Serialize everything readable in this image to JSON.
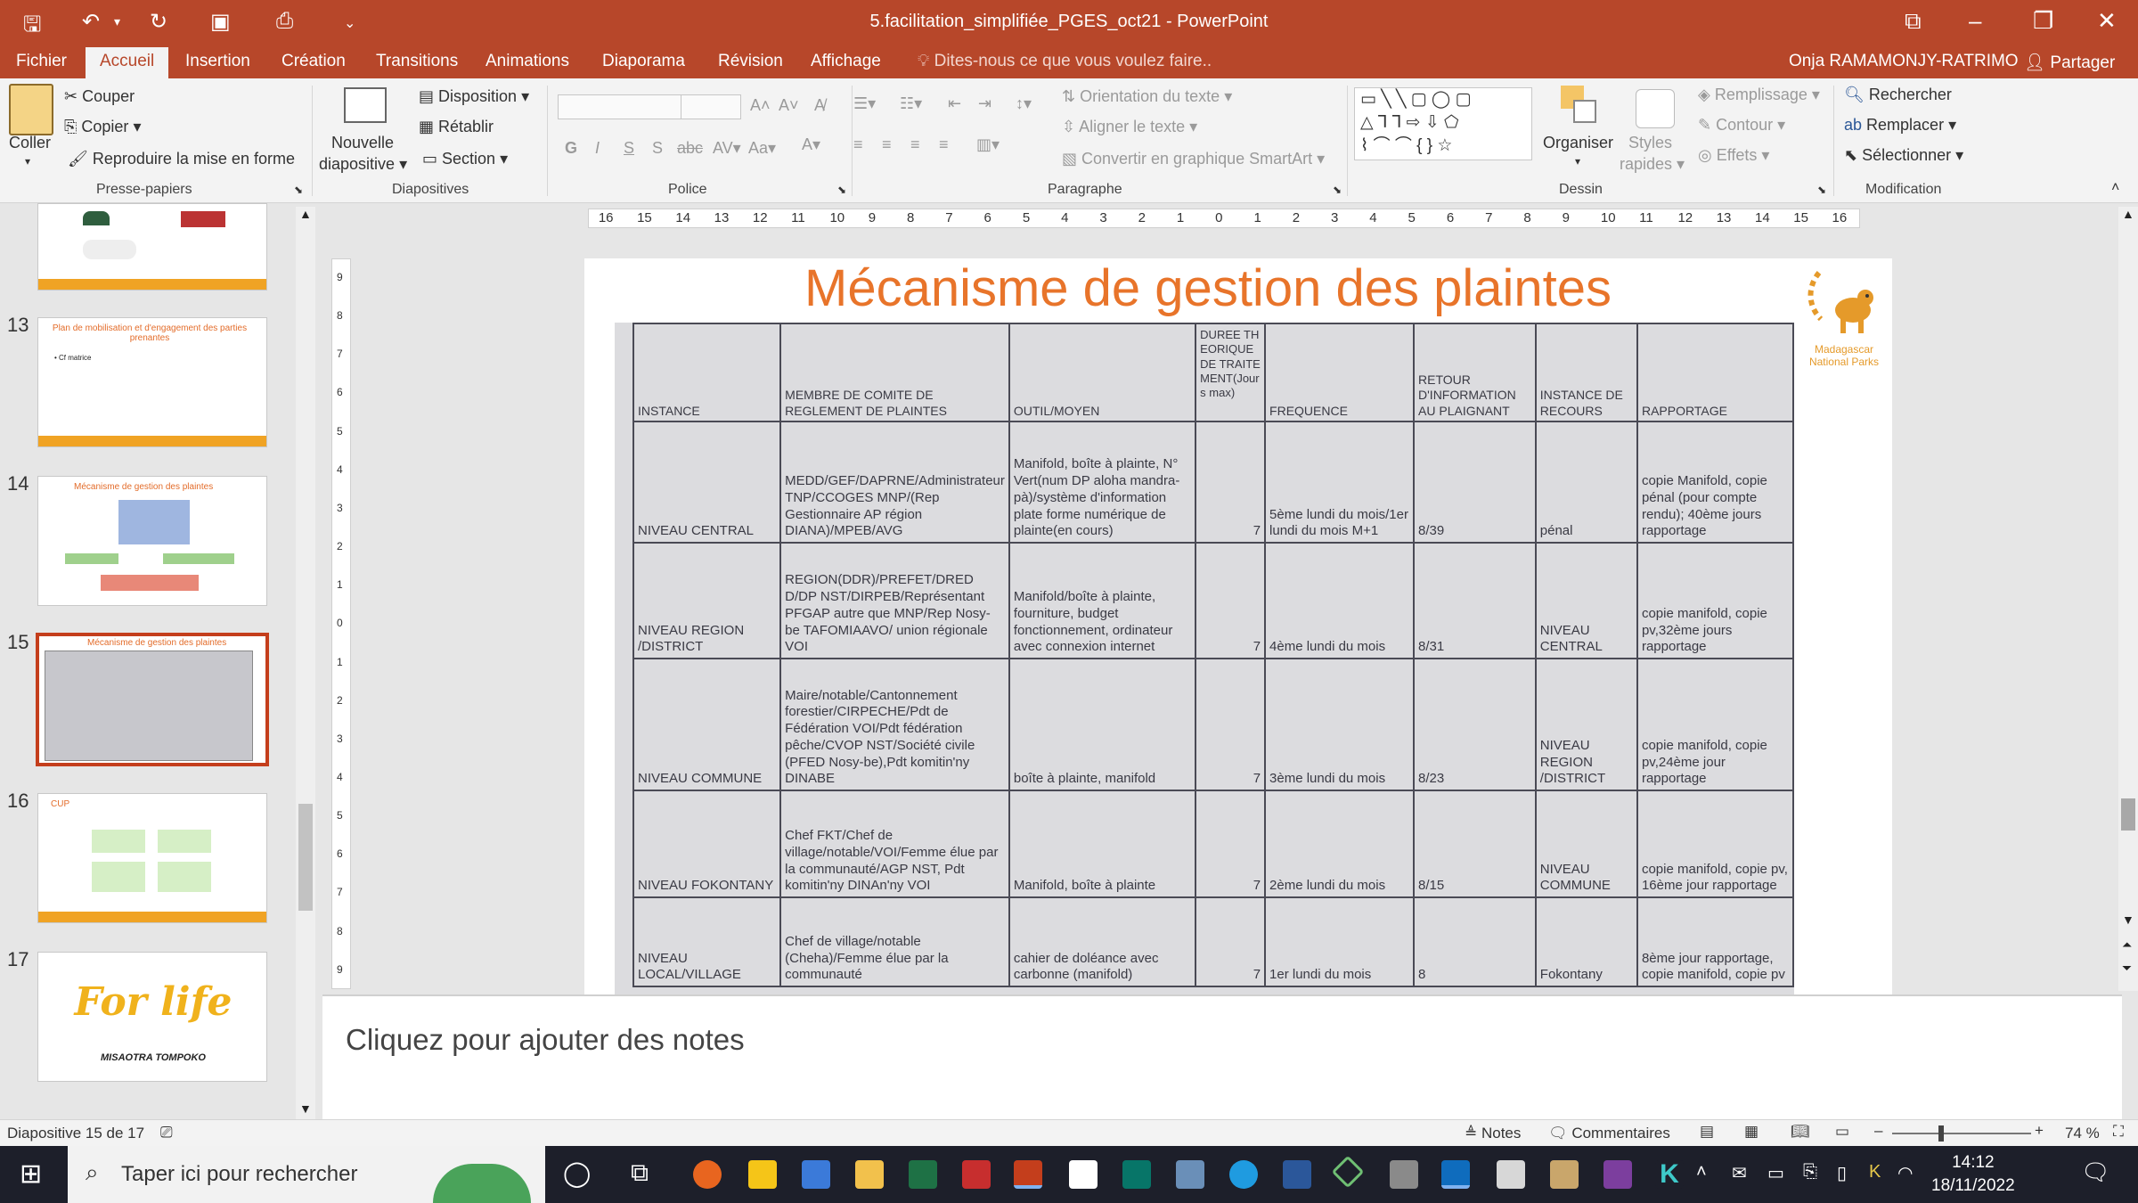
{
  "window": {
    "title": "5.facilitation_simplifiée_PGES_oct21 - PowerPoint",
    "qat_more": "⌄"
  },
  "tabs": [
    "Fichier",
    "Accueil",
    "Insertion",
    "Création",
    "Transitions",
    "Animations",
    "Diaporama",
    "Révision",
    "Affichage"
  ],
  "tell_me": "Dites-nous ce que vous voulez faire..",
  "user": "Onja RAMAMONJY-RATRIMO",
  "share": "Partager",
  "ribbon": {
    "clipboard": {
      "paste": "Coller",
      "cut": "Couper",
      "copy": "Copier",
      "format_painter": "Reproduire la mise en forme",
      "group": "Presse-papiers"
    },
    "slides": {
      "new_slide": "Nouvelle",
      "new_slide2": "diapositive",
      "layout": "Disposition",
      "reset": "Rétablir",
      "section": "Section",
      "group": "Diapositives"
    },
    "font": {
      "group": "Police"
    },
    "paragraph": {
      "text_direction": "Orientation du texte",
      "align_text": "Aligner le texte",
      "smartart": "Convertir en graphique SmartArt",
      "group": "Paragraphe"
    },
    "drawing": {
      "arrange": "Organiser",
      "quick_styles": "Styles",
      "quick_styles2": "rapides",
      "fill": "Remplissage",
      "outline": "Contour",
      "effects": "Effets",
      "group": "Dessin"
    },
    "editing": {
      "find": "Rechercher",
      "replace": "Remplacer",
      "select": "Sélectionner",
      "group": "Modification"
    }
  },
  "ruler": {
    "h_ticks": [
      "16",
      "15",
      "14",
      "13",
      "12",
      "11",
      "10",
      "9",
      "8",
      "7",
      "6",
      "5",
      "4",
      "3",
      "2",
      "1",
      "0",
      "1",
      "2",
      "3",
      "4",
      "5",
      "6",
      "7",
      "8",
      "9",
      "10",
      "11",
      "12",
      "13",
      "14",
      "15",
      "16"
    ],
    "v_ticks": [
      "9",
      "8",
      "7",
      "6",
      "5",
      "4",
      "3",
      "2",
      "1",
      "0",
      "1",
      "2",
      "3",
      "4",
      "5",
      "6",
      "7",
      "8",
      "9"
    ]
  },
  "thumbnails": [
    {
      "num": "",
      "title": ""
    },
    {
      "num": "13",
      "title": "Plan de mobilisation et d'engagement des parties prenantes",
      "bullet": "• Cf matrice"
    },
    {
      "num": "14",
      "title": "Mécanisme de gestion des plaintes"
    },
    {
      "num": "15",
      "title": "Mécanisme de gestion des plaintes"
    },
    {
      "num": "16",
      "title": "CUP"
    },
    {
      "num": "17",
      "title": "For life",
      "subtitle": "MISAOTRA TOMPOKO"
    }
  ],
  "slide": {
    "title": "Mécanisme de gestion des plaintes",
    "logo_text": [
      "Madagascar",
      "National Parks"
    ],
    "table": {
      "headers": [
        "INSTANCE",
        "MEMBRE DE COMITE DE REGLEMENT DE PLAINTES",
        "OUTIL/MOYEN",
        "DUREE THEORIQUE DE TRAITEMENT(Jours max)",
        "FREQUENCE",
        "RETOUR D'INFORMATION AU PLAIGNANT",
        "INSTANCE DE RECOURS",
        "RAPPORTAGE"
      ],
      "rows": [
        [
          "NIVEAU CENTRAL",
          "MEDD/GEF/DAPRNE/Administrateur TNP/CCOGES MNP/(Rep Gestionnaire AP région DIANA)/MPEB/AVG",
          "Manifold, boîte à plainte, N° Vert(num DP aloha mandra-pà)/système d'information plate forme numérique de plainte(en cours)",
          "7",
          "5ème lundi du mois/1er lundi du mois M+1",
          "8/39",
          "pénal",
          "copie Manifold, copie pénal (pour compte rendu); 40ème jours rapportage"
        ],
        [
          "NIVEAU REGION /DISTRICT",
          "REGION(DDR)/PREFET/DRED D/DP NST/DIRPEB/Représentant PFGAP autre que MNP/Rep Nosy-be TAFOMIAAVO/ union régionale VOI",
          "Manifold/boîte à plainte, fourniture, budget fonctionnement, ordinateur avec connexion internet",
          "7",
          "4ème lundi du mois",
          "8/31",
          "NIVEAU CENTRAL",
          "copie manifold, copie pv,32ème jours rapportage"
        ],
        [
          "NIVEAU COMMUNE",
          "Maire/notable/Cantonnement forestier/CIRPECHE/Pdt de Fédération VOI/Pdt fédération pêche/CVOP NST/Société civile (PFED Nosy-be),Pdt komitin'ny DINABE",
          "boîte à plainte, manifold",
          "7",
          "3ème lundi du mois",
          "8/23",
          "NIVEAU REGION /DISTRICT",
          "copie manifold, copie pv,24ème jour rapportage"
        ],
        [
          "NIVEAU FOKONTANY",
          "Chef FKT/Chef de village/notable/VOI/Femme élue par la communauté/AGP NST, Pdt komitin'ny DINAn'ny VOI",
          "Manifold, boîte à plainte",
          "7",
          "2ème lundi du mois",
          "8/15",
          "NIVEAU COMMUNE",
          "copie manifold, copie pv, 16ème jour rapportage"
        ],
        [
          "NIVEAU LOCAL/VILLAGE",
          "Chef de village/notable (Cheha)/Femme élue par la communauté",
          "cahier de doléance avec carbonne (manifold)",
          "7",
          "1er lundi du mois",
          "8",
          "Fokontany",
          "8ème jour rapportage, copie manifold, copie pv"
        ]
      ]
    }
  },
  "notes_placeholder": "Cliquez pour ajouter des notes",
  "status": {
    "slide_info": "Diapositive 15 de 17",
    "notes": "Notes",
    "comments": "Commentaires",
    "zoom": "74 %",
    "zoom_level_pct": 74
  },
  "taskbar": {
    "search_placeholder": "Taper ici pour rechercher",
    "time": "14:12",
    "date": "18/11/2022"
  }
}
